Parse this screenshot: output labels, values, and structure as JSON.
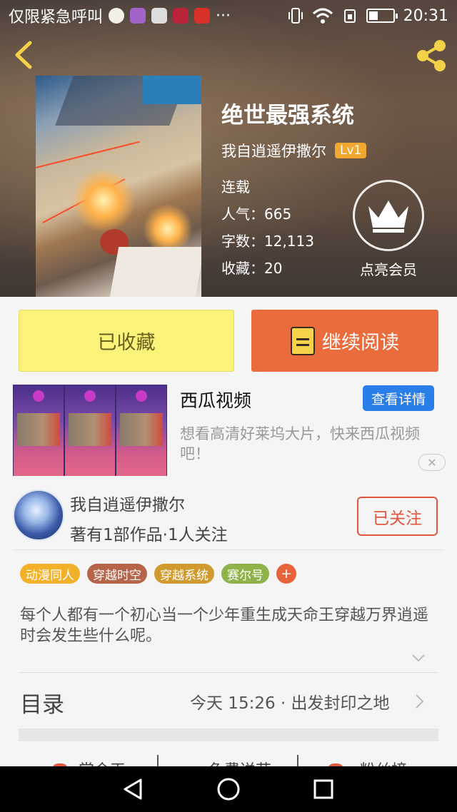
{
  "status_bar": {
    "carrier": "仅限紧急呼叫",
    "more": "···",
    "time": "20:31",
    "battery_level_percent": 45,
    "icons": [
      "emoji-app-icon",
      "gallery-app-icon",
      "text-app-icon",
      "video-app-icon",
      "music-app-icon",
      "vibrate-icon",
      "wifi-icon",
      "data-sim-icon",
      "battery-icon"
    ]
  },
  "header": {
    "back_icon": "chevron-left-icon",
    "share_icon": "share-icon"
  },
  "book": {
    "title": "绝世最强系统",
    "author": "我自逍遥伊撒尔",
    "author_level": "Lv1",
    "status": "连载",
    "popularity": "人气：665",
    "words": "字数：12,113",
    "favorites": "收藏：20",
    "vip_label": "点亮会员"
  },
  "actions": {
    "favorited_label": "已收藏",
    "continue_label": "继续阅读"
  },
  "ad": {
    "title": "西瓜视频",
    "detail_label": "查看详情",
    "description": "想看高清好莱坞大片，快来西瓜视频吧！",
    "close": "✕"
  },
  "author_card": {
    "name": "我自逍遥伊撒尔",
    "stats": "著有1部作品·1人关注",
    "follow_label": "已关注"
  },
  "tags": [
    {
      "label": "动漫同人",
      "color": "#f3b12a"
    },
    {
      "label": "穿越时空",
      "color": "#b5644a"
    },
    {
      "label": "穿越系统",
      "color": "#d09a2e"
    },
    {
      "label": "赛尔号",
      "color": "#8fb24a"
    }
  ],
  "tag_add": "+",
  "summary": "每个人都有一个初心当一个少年重生成天命王穿越万界逍遥时会发生些什么呢。",
  "toc": {
    "label": "目录",
    "latest": "今天 15:26 · 出发封印之地"
  },
  "bottom_tabs": [
    "赏金天",
    "免费送花",
    "粉丝榜"
  ],
  "colors": {
    "accent_orange": "#ea6b3b",
    "favorite_yellow": "#fbf27a",
    "follow_red": "#e2553e",
    "ad_blue": "#2a7ee8"
  }
}
